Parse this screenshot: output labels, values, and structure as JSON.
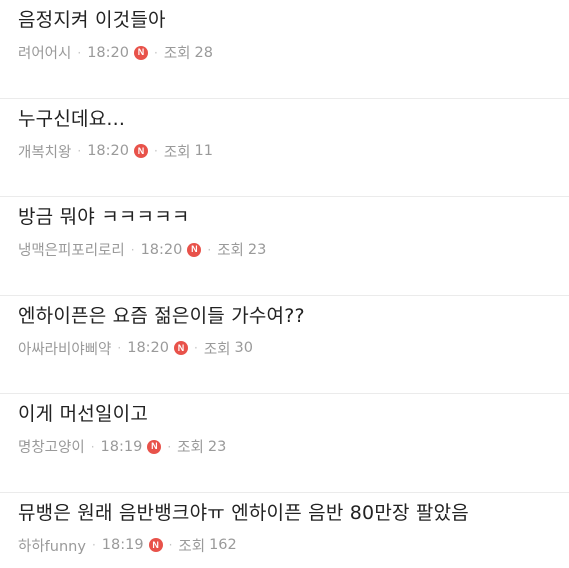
{
  "posts": [
    {
      "title": "음정지켜 이것들아",
      "author": "려어어시",
      "time": "18:20",
      "new_badge": "N",
      "views_label": "조회",
      "views": "28"
    },
    {
      "title": "누구신데요...",
      "author": "개복치왕",
      "time": "18:20",
      "new_badge": "N",
      "views_label": "조회",
      "views": "11"
    },
    {
      "title": "방금 뭐야 ㅋㅋㅋㅋㅋ",
      "author": "냉맥은피포리로리",
      "time": "18:20",
      "new_badge": "N",
      "views_label": "조회",
      "views": "23"
    },
    {
      "title": "엔하이픈은 요즘 젊은이들 가수여??",
      "author": "아싸라비야삐약",
      "time": "18:20",
      "new_badge": "N",
      "views_label": "조회",
      "views": "30"
    },
    {
      "title": "이게 머선일이고",
      "author": "명창고양이",
      "time": "18:19",
      "new_badge": "N",
      "views_label": "조회",
      "views": "23"
    },
    {
      "title": "뮤뱅은 원래 음반뱅크야ㅠ 엔하이픈 음반 80만장 팔았음",
      "author": "하하funny",
      "time": "18:19",
      "new_badge": "N",
      "views_label": "조회",
      "views": "162"
    }
  ],
  "colors": {
    "badge": "#e8524a",
    "title": "#222222",
    "meta": "#9a9a9a",
    "divider": "#ebebeb"
  },
  "icons": {
    "separator": "middle-dot",
    "new": "new-badge-icon"
  }
}
